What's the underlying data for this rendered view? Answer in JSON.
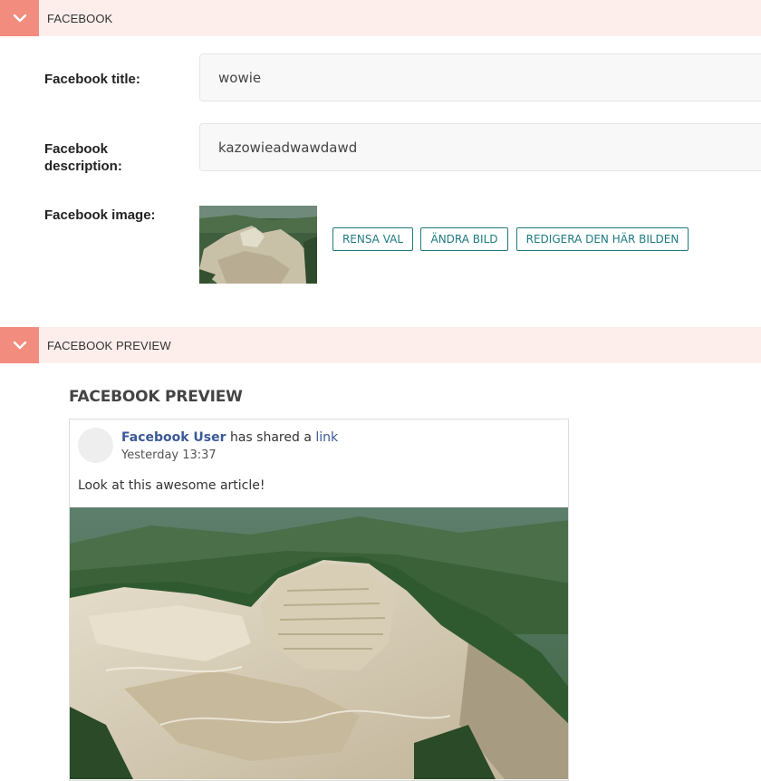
{
  "sections": {
    "facebook": {
      "title": "FACEBOOK"
    },
    "preview": {
      "title": "FACEBOOK PREVIEW"
    }
  },
  "form": {
    "title_label": "Facebook title:",
    "title_value": "wowie",
    "description_label": "Facebook description:",
    "description_value": "kazowieadwawdawd",
    "image_label": "Facebook image:",
    "buttons": {
      "clear": "RENSA VAL",
      "change": "ÄNDRA BILD",
      "edit": "REDIGERA DEN HÄR BILDEN"
    }
  },
  "preview": {
    "heading": "FACEBOOK PREVIEW",
    "user": "Facebook User",
    "shared_text": " has shared a ",
    "link_text": "link",
    "timestamp": "Yesterday 13:37",
    "message": "Look at this awesome article!"
  },
  "colors": {
    "accent": "#f18c7e",
    "header_bg": "#fdeeec",
    "button": "#1e7a80",
    "fb_blue": "#3b5998"
  },
  "icons": {
    "toggle": "chevron-down-icon"
  }
}
